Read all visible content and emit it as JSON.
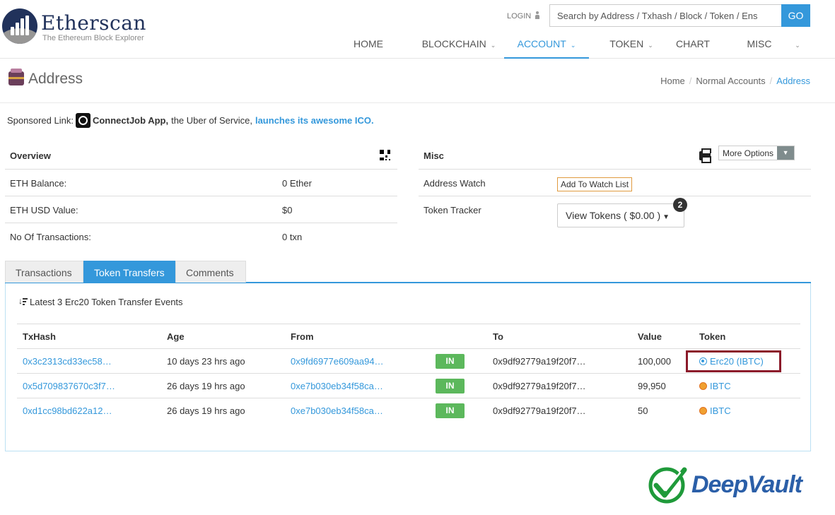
{
  "brand": {
    "name": "Etherscan",
    "tagline": "The Ethereum Block Explorer",
    "color": "#21325b"
  },
  "header": {
    "login_label": "LOGIN",
    "search": {
      "placeholder": "Search by Address / Txhash / Block / Token / Ens",
      "button_label": "GO"
    },
    "nav": [
      {
        "label": "HOME",
        "has_caret": false,
        "active": false
      },
      {
        "label": "BLOCKCHAIN",
        "has_caret": true,
        "active": false
      },
      {
        "label": "ACCOUNT",
        "has_caret": true,
        "active": true
      },
      {
        "label": "TOKEN",
        "has_caret": true,
        "active": false
      },
      {
        "label": "CHART",
        "has_caret": false,
        "active": false
      },
      {
        "label": "MISC",
        "has_caret": false,
        "active": false
      }
    ],
    "extra_caret": "⌄"
  },
  "page": {
    "title": "Address",
    "breadcrumb": [
      "Home",
      "Normal Accounts",
      "Address"
    ]
  },
  "sponsored": {
    "prefix": "Sponsored Link:",
    "app_name": "ConnectJob App,",
    "middle": "the Uber of Service,",
    "link": "launches its awesome ICO."
  },
  "overview": {
    "heading": "Overview",
    "rows": [
      {
        "key": "ETH Balance:",
        "value": "0 Ether"
      },
      {
        "key": "ETH USD Value:",
        "value": "$0"
      },
      {
        "key": "No Of Transactions:",
        "value": "0 txn"
      }
    ]
  },
  "misc": {
    "heading": "Misc",
    "more_options": "More Options",
    "address_watch_label": "Address Watch",
    "watch_button": "Add To Watch List",
    "token_tracker_label": "Token Tracker",
    "view_tokens": "View Tokens ( $0.00 )",
    "token_count": "2"
  },
  "tabs": [
    {
      "label": "Transactions",
      "active": false
    },
    {
      "label": "Token Transfers",
      "active": true
    },
    {
      "label": "Comments",
      "active": false
    }
  ],
  "transfers": {
    "summary": "Latest 3 Erc20 Token Transfer Events",
    "columns": [
      "TxHash",
      "Age",
      "From",
      "",
      "To",
      "Value",
      "Token"
    ],
    "rows": [
      {
        "txhash": "0x3c2313cd33ec58…",
        "age": "10 days 23 hrs ago",
        "from": "0x9fd6977e609aa94…",
        "direction": "IN",
        "to": "0x9df92779a19f20f7…",
        "value": "100,000",
        "token": "Erc20 (IBTC)",
        "token_icon": "erc20-icon"
      },
      {
        "txhash": "0x5d709837670c3f7…",
        "age": "26 days 19 hrs ago",
        "from": "0xe7b030eb34f58ca…",
        "direction": "IN",
        "to": "0x9df92779a19f20f7…",
        "value": "99,950",
        "token": "IBTC",
        "token_icon": "ibtc-icon"
      },
      {
        "txhash": "0xd1cc98bd622a12…",
        "age": "26 days 19 hrs ago",
        "from": "0xe7b030eb34f58ca…",
        "direction": "IN",
        "to": "0x9df92779a19f20f7…",
        "value": "50",
        "token": "IBTC",
        "token_icon": "ibtc-icon"
      }
    ]
  },
  "watermark": {
    "text": "DeepVault"
  },
  "colors": {
    "accent": "#3498db",
    "in_badge": "#5cb85c",
    "highlight": "#8b1a2a"
  }
}
